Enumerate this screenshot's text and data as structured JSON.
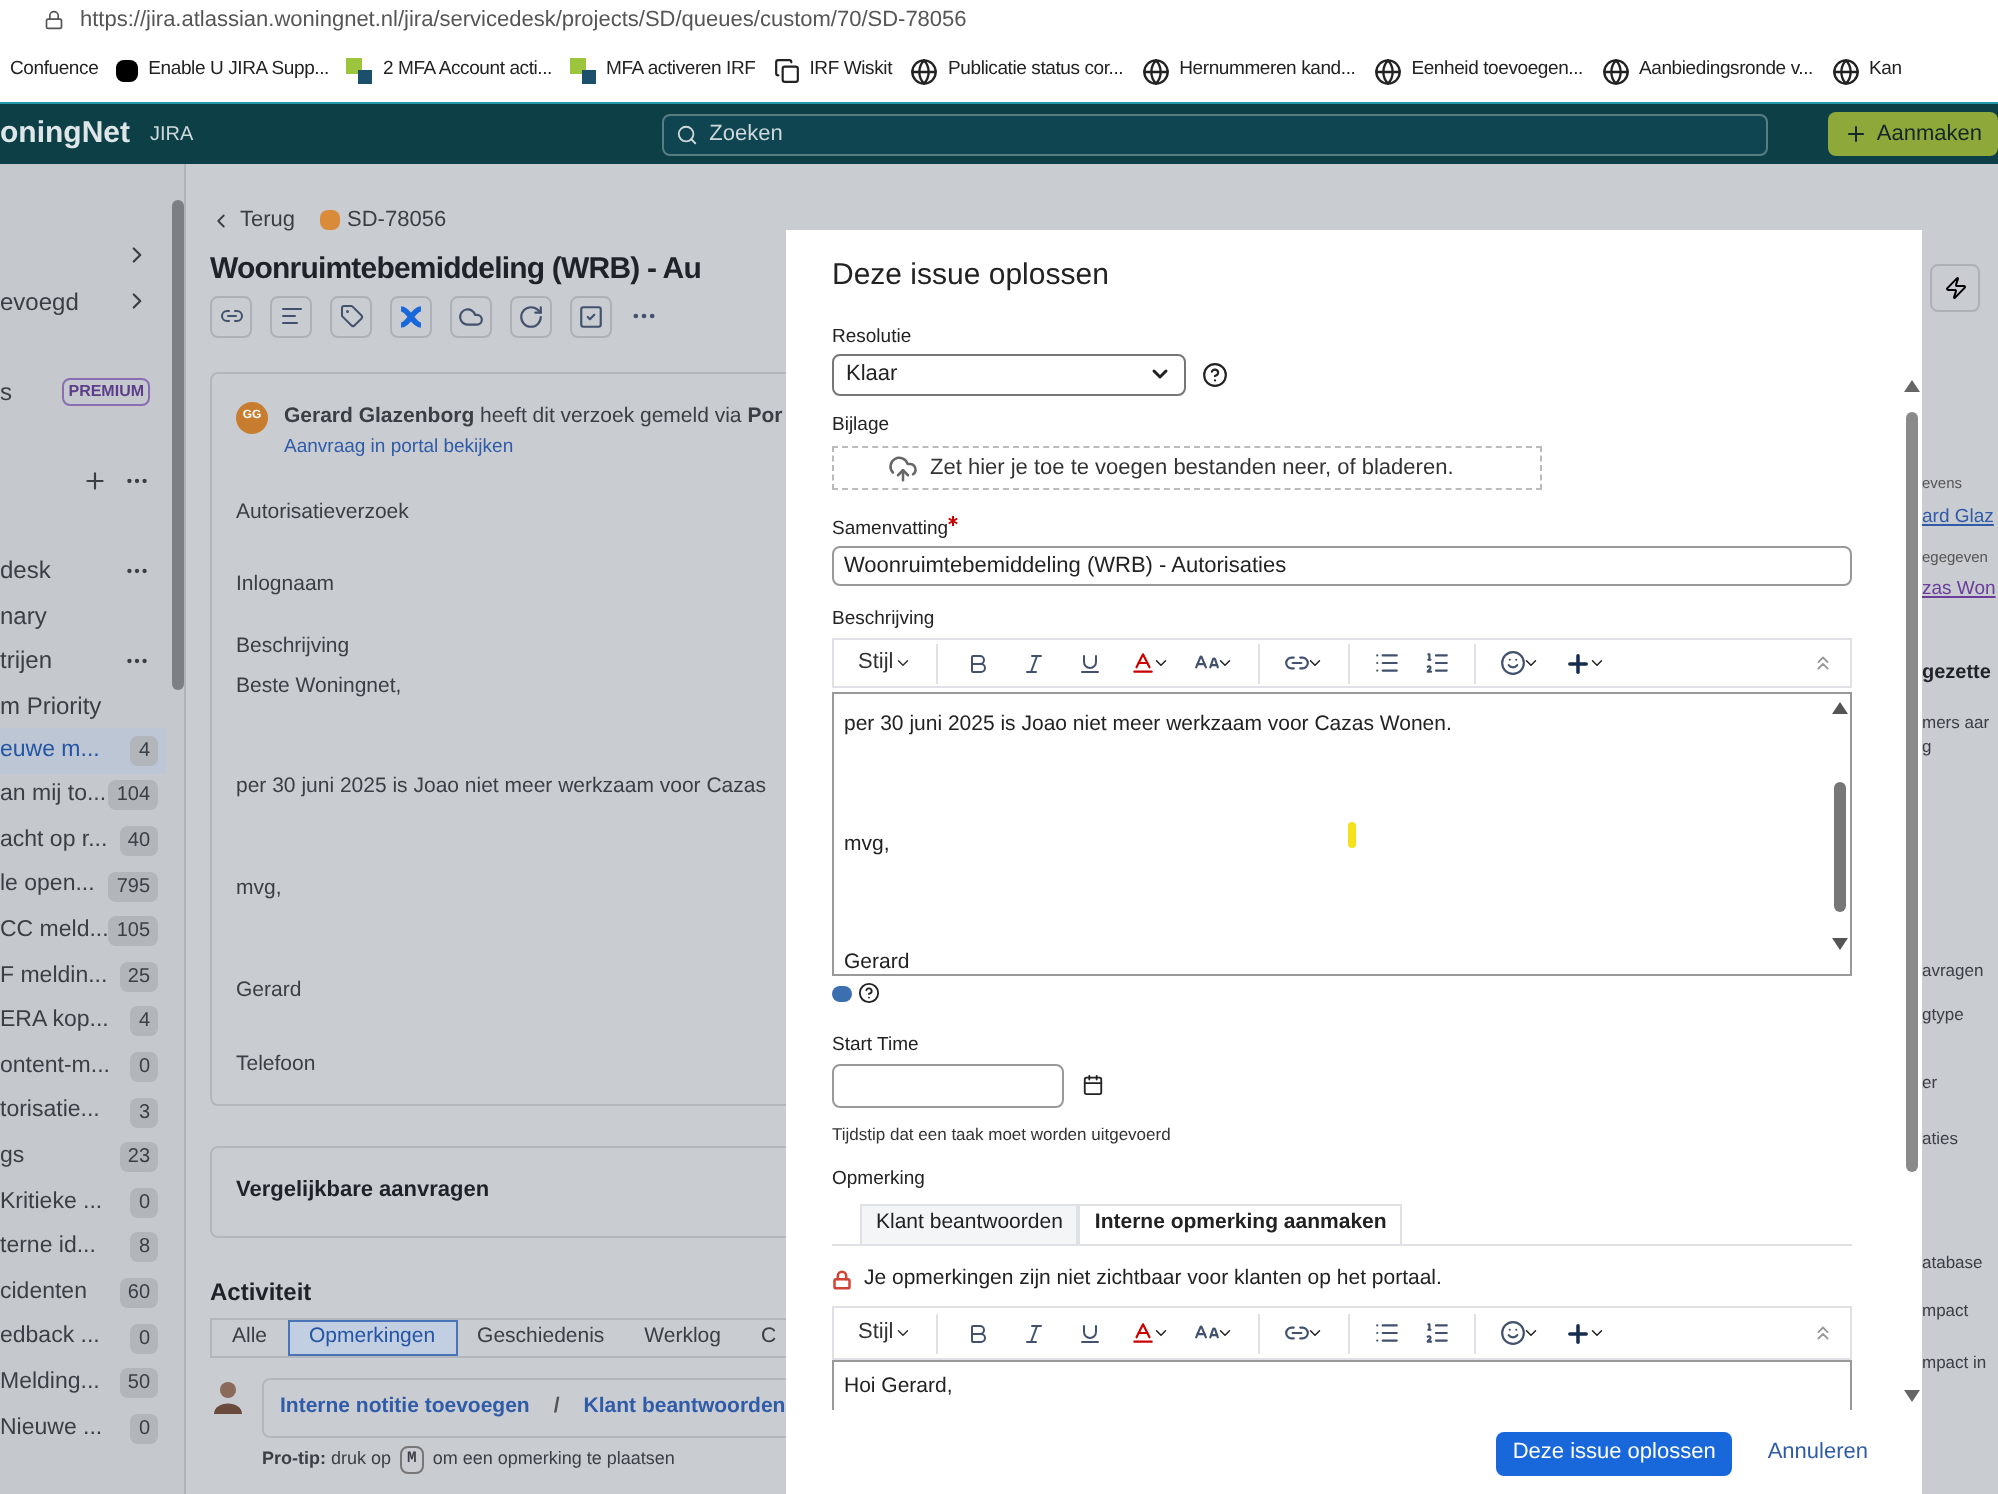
{
  "browser": {
    "url": "https://jira.atlassian.woningnet.nl/jira/servicedesk/projects/SD/queues/custom/70/SD-78056",
    "bookmarks": [
      {
        "kind": "plain",
        "label": "Confuence"
      },
      {
        "kind": "u",
        "label": "Enable U JIRA Supp..."
      },
      {
        "kind": "squares",
        "label": "2 MFA Account acti..."
      },
      {
        "kind": "squares",
        "label": "MFA activeren IRF"
      },
      {
        "kind": "copy",
        "label": "IRF Wiskit"
      },
      {
        "kind": "globe",
        "label": "Publicatie status cor..."
      },
      {
        "kind": "globe",
        "label": "Hernummeren kand..."
      },
      {
        "kind": "globe",
        "label": "Eenheid toevoegen..."
      },
      {
        "kind": "globe",
        "label": "Aanbiedingsronde v..."
      },
      {
        "kind": "globe",
        "label": "Kan"
      }
    ]
  },
  "header": {
    "logo": "oningNet",
    "product": "JIRA",
    "search": {
      "placeholder": "Zoeken"
    },
    "create": "Aanmaken"
  },
  "sidebar": {
    "items": [
      {
        "kind": "expand"
      },
      {
        "kind": "expand",
        "label": "evoegd"
      },
      {
        "kind": "premium",
        "label": "s",
        "badge": "PREMIUM"
      },
      {
        "kind": "actions"
      },
      {
        "kind": "menu",
        "label": "desk",
        "more": true
      },
      {
        "kind": "menu",
        "label": "nary",
        "more": false
      },
      {
        "kind": "menu",
        "label": "trijen",
        "more": true
      },
      {
        "kind": "menu",
        "label": "m Priority",
        "more": false
      }
    ],
    "queues": [
      {
        "label": "euwe m...",
        "count": "4",
        "selected": true
      },
      {
        "label": "an mij to...",
        "count": "104",
        "selected": false
      },
      {
        "label": "acht op r...",
        "count": "40",
        "selected": false
      },
      {
        "label": "le open...",
        "count": "795",
        "selected": false
      },
      {
        "label": "CC meld...",
        "count": "105",
        "selected": false
      },
      {
        "label": "F meldin...",
        "count": "25",
        "selected": false
      },
      {
        "label": "ERA kop...",
        "count": "4",
        "selected": false
      },
      {
        "label": "ontent-m...",
        "count": "0",
        "selected": false
      },
      {
        "label": "torisatie...",
        "count": "3",
        "selected": false
      },
      {
        "label": "gs",
        "count": "23",
        "selected": false
      },
      {
        "label": "Kritieke ...",
        "count": "0",
        "selected": false
      },
      {
        "label": "terne id...",
        "count": "8",
        "selected": false
      },
      {
        "label": "cidenten",
        "count": "60",
        "selected": false
      },
      {
        "label": "edback ...",
        "count": "0",
        "selected": false
      },
      {
        "label": "Melding...",
        "count": "50",
        "selected": false
      },
      {
        "label": "Nieuwe ...",
        "count": "0",
        "selected": false
      }
    ]
  },
  "issue": {
    "back": "Terug",
    "key": "SD-78056",
    "title": "Woonruimtebemiddeling (WRB) - Au",
    "request": {
      "avatar": "GG",
      "reported": "**Gerard Glazenborg** heeft dit verzoek gemeld via **Por**",
      "portal_link": "Aanvraag in portal bekijken",
      "lines": [
        "Autorisatieverzoek",
        "Inlognaam",
        "Beschrijving",
        "Beste Woningnet,",
        "per 30 juni 2025 is Joao niet meer werkzaam voor Cazas",
        "mvg,",
        "Gerard",
        "Telefoon"
      ]
    },
    "similar": "Vergelijkbare aanvragen",
    "activity": {
      "title": "Activiteit",
      "tabs": [
        {
          "label": "Alle",
          "selected": false
        },
        {
          "label": "Opmerkingen",
          "selected": true
        },
        {
          "label": "Geschiedenis",
          "selected": false
        },
        {
          "label": "Werklog",
          "selected": false
        },
        {
          "label": "C",
          "selected": false
        }
      ],
      "internal_note": "Interne notitie toevoegen",
      "separator": "/",
      "reply": "Klant beantwoorden",
      "protip_before": "**Pro-tip:** druk op",
      "protip_key": "M",
      "protip_after": "om een opmerking te plaatsen"
    }
  },
  "right_panel": [
    {
      "kind": "label",
      "text": "evens"
    },
    {
      "kind": "link",
      "text": "ard Glaz"
    },
    {
      "kind": "label",
      "text": "egegeven"
    },
    {
      "kind": "visited",
      "text": "zas Won"
    },
    {
      "kind": "heading",
      "text": "gezette"
    },
    {
      "kind": "text",
      "text": "mers aar"
    },
    {
      "kind": "text",
      "text": "g"
    },
    {
      "kind": "text",
      "text": "avragen"
    },
    {
      "kind": "text",
      "text": "gtype"
    },
    {
      "kind": "text",
      "text": "er"
    },
    {
      "kind": "text",
      "text": "aties"
    },
    {
      "kind": "text",
      "text": "atabase"
    },
    {
      "kind": "text",
      "text": "mpact"
    },
    {
      "kind": "text",
      "text": "mpact in"
    }
  ],
  "dialog": {
    "title": "Deze issue oplossen",
    "resolution": {
      "label": "Resolutie",
      "value": "Klaar"
    },
    "attachment": {
      "label": "Bijlage",
      "dropzone": "Zet hier je toe te voegen bestanden neer, of bladeren."
    },
    "summary": {
      "label": "Samenvatting",
      "required": true,
      "value": "Woonruimtebemiddeling (WRB) - Autorisaties"
    },
    "description": {
      "label": "Beschrijving",
      "style": "Stijl",
      "lines": [
        "per 30 juni 2025 is Joao niet meer werkzaam voor Cazas Wonen.",
        "mvg,",
        "Gerard"
      ]
    },
    "start_time": {
      "label": "Start Time",
      "hint": "Tijdstip dat een taak moet worden uitgevoerd"
    },
    "comment": {
      "label": "Opmerking",
      "tabs": [
        {
          "label": "Klant beantwoorden",
          "selected": false
        },
        {
          "label": "Interne opmerking aanmaken",
          "selected": true
        }
      ],
      "notice": "Je opmerkingen zijn niet zichtbaar voor klanten op het portaal.",
      "style": "Stijl",
      "value": "Hoi Gerard,"
    },
    "submit": "Deze issue oplossen",
    "cancel": "Annuleren"
  }
}
